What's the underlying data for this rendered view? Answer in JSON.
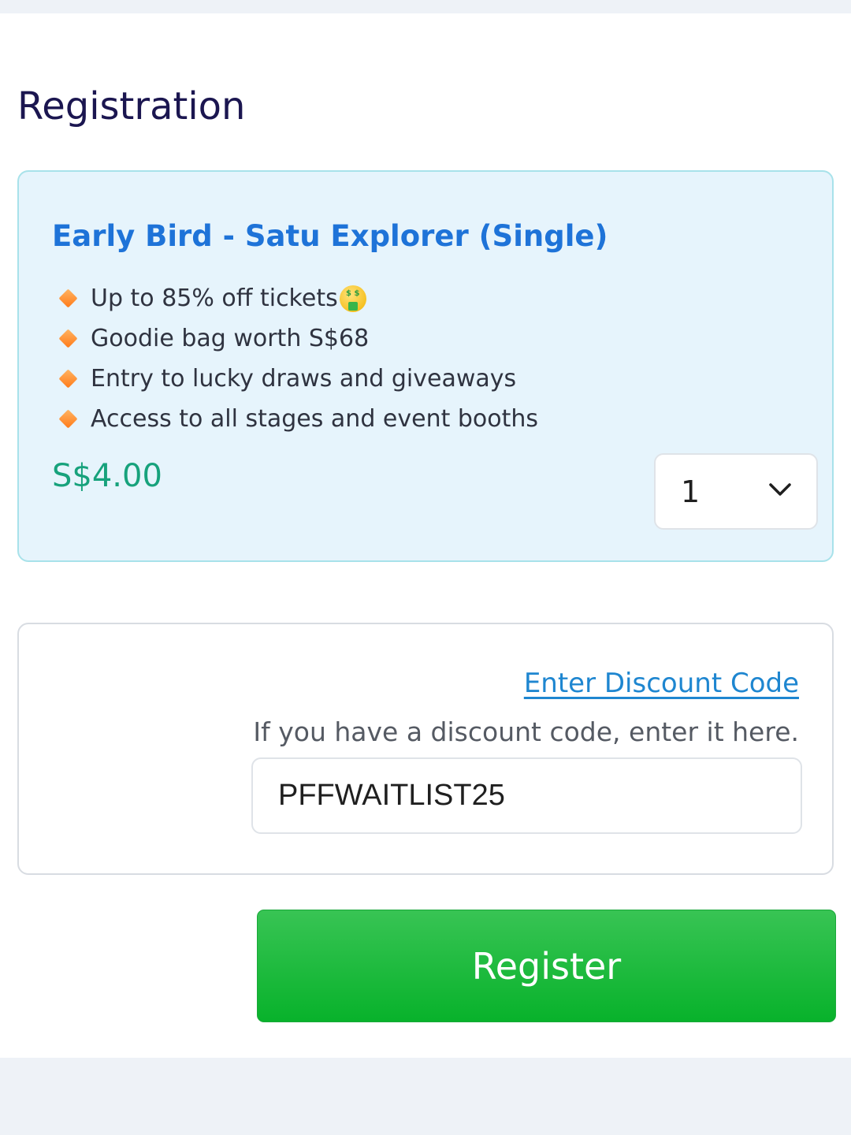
{
  "page": {
    "title": "Registration"
  },
  "ticket": {
    "name": "Early Bird - Satu Explorer (Single)",
    "perks": [
      "Up to 85% off tickets",
      "Goodie bag worth S$68",
      "Entry to lucky draws and giveaways",
      "Access to all stages and event booths"
    ],
    "perk_icon": "orange-diamond-icon",
    "first_perk_emoji": "money-mouth-face-icon",
    "price": "S$4.00",
    "quantity": "1"
  },
  "discount": {
    "link_label": "Enter Discount Code",
    "help_text": "If you have a discount code, enter it here.",
    "value": "PFFWAITLIST25"
  },
  "actions": {
    "register_label": "Register"
  },
  "colors": {
    "title": "#1b1650",
    "ticket_name": "#1e73d8",
    "price": "#17a27c",
    "link": "#1e86d0",
    "register_button": "#08b22b",
    "card_background": "#e6f4fc",
    "card_border": "#a8e2ea"
  }
}
